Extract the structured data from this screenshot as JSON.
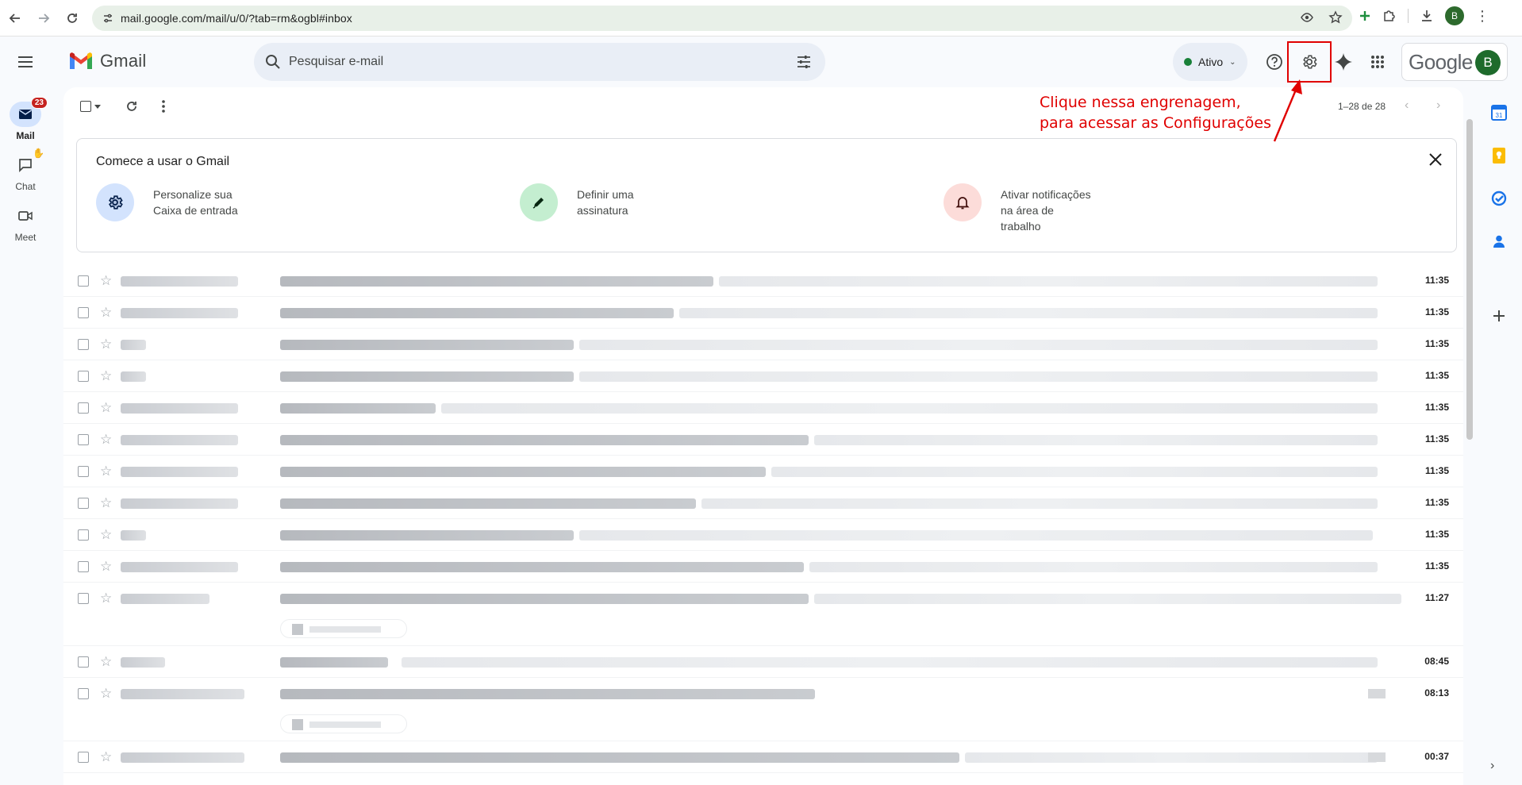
{
  "browser": {
    "url": "mail.google.com/mail/u/0/?tab=rm&ogbl#inbox",
    "profile_initial": "B"
  },
  "header": {
    "app_name": "Gmail",
    "search_placeholder": "Pesquisar e-mail",
    "status_label": "Ativo",
    "google_wordmark": "Google",
    "avatar_initial": "B"
  },
  "rail": {
    "items": [
      {
        "label": "Mail",
        "badge": "23",
        "icon": "mail-icon"
      },
      {
        "label": "Chat",
        "icon": "chat-icon"
      },
      {
        "label": "Meet",
        "icon": "meet-icon"
      }
    ]
  },
  "toolbar": {
    "pager": "1–28 de 28"
  },
  "annotation": {
    "line1": "Clique nessa engrenagem,",
    "line2": "para acessar as Configurações",
    "color": "#e00000"
  },
  "card": {
    "title": "Comece a usar o Gmail",
    "tips": [
      {
        "text": "Personalize sua\nCaixa de entrada",
        "icon": "settings-gear-icon",
        "bg": "#d3e3fd"
      },
      {
        "text": "Definir uma\nassinatura",
        "icon": "pen-icon",
        "bg": "#c4eed0"
      },
      {
        "text": "Ativar notificações\nna área de\ntrabalho",
        "icon": "bell-icon",
        "bg": "#fcdcd9"
      }
    ]
  },
  "emails": [
    {
      "time": "11:35"
    },
    {
      "time": "11:35"
    },
    {
      "time": "11:35"
    },
    {
      "time": "11:35"
    },
    {
      "time": "11:35"
    },
    {
      "time": "11:35"
    },
    {
      "time": "11:35"
    },
    {
      "time": "11:35"
    },
    {
      "time": "11:35"
    },
    {
      "time": "11:35"
    },
    {
      "time": "11:27"
    },
    {
      "time": "08:45"
    },
    {
      "time": "08:13"
    },
    {
      "time": "00:37"
    }
  ],
  "colors": {
    "accent": "#0b57d0",
    "badge": "#c5221f",
    "status_green": "#188038"
  }
}
